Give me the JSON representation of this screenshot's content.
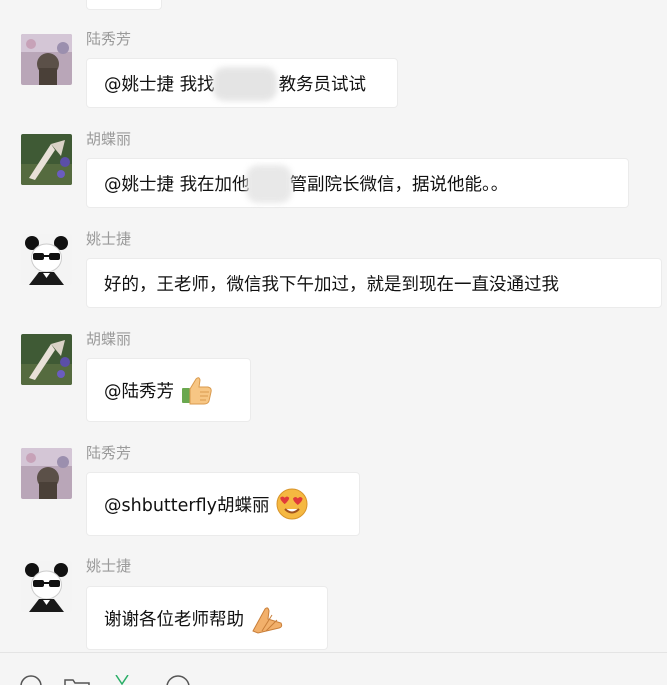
{
  "messages": [
    {
      "sender": "陆秀芳",
      "text": "@姚士捷 我找■■■■教务员试试"
    },
    {
      "sender": "胡蝶丽",
      "text": "@姚士捷 我在加他■■■■管副院长微信，据说他能。。"
    },
    {
      "sender": "姚士捷",
      "text": "好的，王老师，微信我下午加过，就是到现在一直没通过我"
    },
    {
      "sender": "胡蝶丽",
      "text": "@陆秀芳",
      "emoji": "thumbs-up"
    },
    {
      "sender": "陆秀芳",
      "text": "@shbutterfly胡蝶丽",
      "emoji": "heart-eyes"
    },
    {
      "sender": "姚士捷",
      "text": "谢谢各位老师帮助",
      "emoji": "folded-hands"
    }
  ],
  "segments": {
    "m1a": "@姚士捷 我找",
    "m1b": "教务员试试",
    "m2a": "@姚士捷 我在加他",
    "m2b": "管副院长微信，据说他能。。"
  },
  "toolbar_icons": [
    "emoji-icon",
    "folder-icon",
    "scissors-icon",
    "chat-bubble-icon"
  ]
}
